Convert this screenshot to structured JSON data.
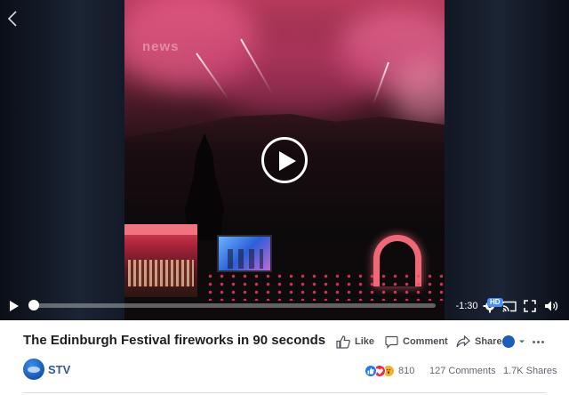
{
  "video": {
    "watermark": "news",
    "controls": {
      "time_remaining": "-1:30",
      "hd_label": "HD",
      "progress": 0.0
    }
  },
  "post": {
    "title": "The Edinburgh Festival fireworks in 90 seconds",
    "actions": {
      "like": "Like",
      "comment": "Comment",
      "share": "Share"
    },
    "page_name": "STV",
    "reaction_count": "810",
    "comments": "127 Comments",
    "shares": "1.7K Shares"
  },
  "colors": {
    "page_name": "#365899",
    "like_reaction": "#2078f4",
    "love_reaction": "#f0284a",
    "wow_reaction": "#f7b125",
    "hd_badge": "#4a8ff6"
  },
  "icons": [
    "chevron-left-icon",
    "play-icon",
    "settings-icon",
    "cast-icon",
    "fullscreen-icon",
    "volume-icon",
    "thumbs-up-icon",
    "comment-bubble-icon",
    "share-arrow-icon",
    "caret-down-icon",
    "more-dots-icon"
  ]
}
